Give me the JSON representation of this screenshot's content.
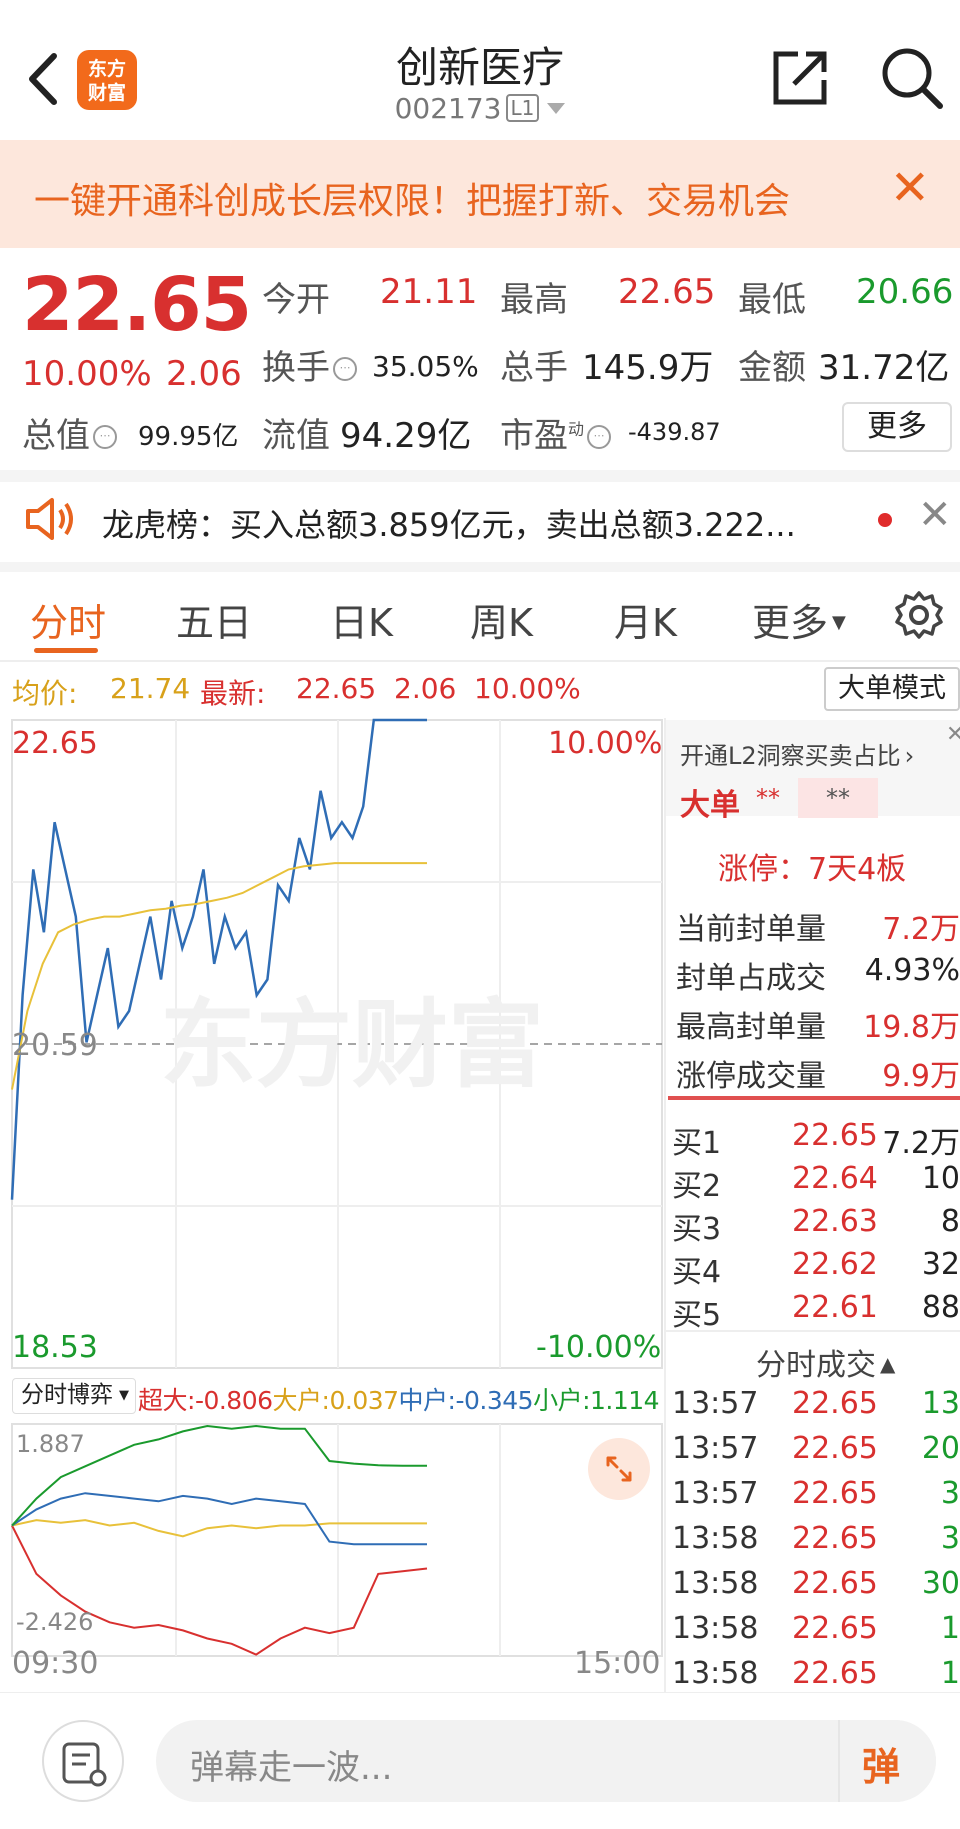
{
  "header": {
    "title": "创新医疗",
    "code": "002173",
    "level_badge": "L1",
    "logo_line1": "东方",
    "logo_line2": "财富"
  },
  "banner": {
    "text": "一键开通科创成长层权限！把握打新、交易机会"
  },
  "quote": {
    "price": "22.65",
    "change_pct": "10.00%",
    "change": "2.06",
    "open_label": "今开",
    "open": "21.11",
    "high_label": "最高",
    "high": "22.65",
    "low_label": "最低",
    "low": "20.66",
    "turnover_label": "换手",
    "turnover": "35.05%",
    "volume_label": "总手",
    "volume": "145.9万",
    "amount_label": "金额",
    "amount": "31.72亿",
    "mktcap_label": "总值",
    "mktcap": "99.95亿",
    "float_label": "流值",
    "float": "94.29亿",
    "pe_label": "市盈",
    "pe_sup": "动",
    "pe": "-439.87",
    "more": "更多"
  },
  "notice": {
    "text": "龙虎榜：买入总额3.859亿元，卖出总额3.222..."
  },
  "tabs": [
    "分时",
    "五日",
    "日K",
    "周K",
    "月K",
    "更多"
  ],
  "info_line": {
    "avg_label": "均价:",
    "avg": "21.74",
    "latest_label": "最新:",
    "latest": "22.65",
    "change": "2.06",
    "pct": "10.00%",
    "mode_button": "大单模式"
  },
  "chart_data": {
    "type": "line",
    "title": "",
    "x_start": "09:30",
    "x_end": "15:00",
    "y_top": "22.65",
    "y_mid": "20.59",
    "y_bottom": "18.53",
    "pct_top": "10.00%",
    "pct_bottom": "-10.00%",
    "ylim": [
      18.53,
      22.65
    ],
    "watermark": "东方财富",
    "series": [
      {
        "color": "#2f6db5",
        "values": [
          19.6,
          20.9,
          21.7,
          21.3,
          22.0,
          21.7,
          21.4,
          20.6,
          20.9,
          21.2,
          20.7,
          20.8,
          21.1,
          21.4,
          21.0,
          21.5,
          21.2,
          21.4,
          21.7,
          21.1,
          21.4,
          21.2,
          21.3,
          20.9,
          21.0,
          21.6,
          21.5,
          21.9,
          21.7,
          22.2,
          21.9,
          22.0,
          21.9,
          22.1,
          22.65,
          22.65,
          22.65,
          22.65,
          22.65,
          22.65
        ]
      },
      {
        "color": "#e8c13a",
        "values": [
          20.3,
          20.8,
          21.1,
          21.3,
          21.35,
          21.38,
          21.4,
          21.4,
          21.42,
          21.44,
          21.45,
          21.47,
          21.48,
          21.5,
          21.52,
          21.55,
          21.6,
          21.65,
          21.7,
          21.72,
          21.73,
          21.74,
          21.74,
          21.74,
          21.74,
          21.74,
          21.74,
          21.74
        ]
      }
    ]
  },
  "flow": {
    "selector": "分时博弈",
    "super_label": "超大:",
    "super": "-0.806",
    "large_label": "大户:",
    "large": "0.037",
    "mid_label": "中户:",
    "mid": "-0.345",
    "small_label": "小户:",
    "small": "1.114",
    "ymax": "1.887",
    "ymin": "-2.426",
    "series": [
      {
        "name": "超大",
        "color": "#d8302f",
        "values": [
          0,
          -0.9,
          -1.3,
          -1.6,
          -1.8,
          -1.9,
          -1.85,
          -1.95,
          -2.1,
          -2.2,
          -2.4,
          -2.1,
          -1.9,
          -2.0,
          -1.9,
          -0.9,
          -0.85,
          -0.8
        ]
      },
      {
        "name": "大户",
        "color": "#e8c13a",
        "values": [
          0,
          0.1,
          0.05,
          0.1,
          0.0,
          0.05,
          -0.1,
          -0.2,
          -0.05,
          0.0,
          -0.05,
          0.0,
          0.0,
          0.04,
          0.04,
          0.04,
          0.04,
          0.04
        ]
      },
      {
        "name": "中户",
        "color": "#2f6db5",
        "values": [
          0,
          0.3,
          0.5,
          0.6,
          0.55,
          0.5,
          0.45,
          0.55,
          0.5,
          0.4,
          0.5,
          0.45,
          0.4,
          -0.3,
          -0.35,
          -0.35,
          -0.35,
          -0.35
        ]
      },
      {
        "name": "小户",
        "color": "#1a9a2d",
        "values": [
          0,
          0.5,
          0.9,
          1.1,
          1.3,
          1.5,
          1.6,
          1.75,
          1.85,
          1.8,
          1.85,
          1.8,
          1.8,
          1.2,
          1.15,
          1.12,
          1.11,
          1.11
        ]
      }
    ]
  },
  "right_panel": {
    "l2_text": "开通L2洞察买卖占比",
    "big_order_label": "大单",
    "big_order_a": "**",
    "big_order_b": "**",
    "limit_up": "涨停：7天4板",
    "stats": [
      {
        "label": "当前封单量",
        "value": "7.2万",
        "color": "red"
      },
      {
        "label": "封单占成交",
        "value": "4.93%",
        "color": "black"
      },
      {
        "label": "最高封单量",
        "value": "19.8万",
        "color": "red"
      },
      {
        "label": "涨停成交量",
        "value": "9.9万",
        "color": "red"
      }
    ],
    "bids": [
      {
        "label": "买1",
        "price": "22.65",
        "vol": "7.2万"
      },
      {
        "label": "买2",
        "price": "22.64",
        "vol": "10"
      },
      {
        "label": "买3",
        "price": "22.63",
        "vol": "8"
      },
      {
        "label": "买4",
        "price": "22.62",
        "vol": "32"
      },
      {
        "label": "买5",
        "price": "22.61",
        "vol": "88"
      }
    ],
    "trades_title": "分时成交",
    "trades": [
      {
        "time": "13:57",
        "price": "22.65",
        "vol": "13"
      },
      {
        "time": "13:57",
        "price": "22.65",
        "vol": "20"
      },
      {
        "time": "13:57",
        "price": "22.65",
        "vol": "3"
      },
      {
        "time": "13:58",
        "price": "22.65",
        "vol": "3"
      },
      {
        "time": "13:58",
        "price": "22.65",
        "vol": "30"
      },
      {
        "time": "13:58",
        "price": "22.65",
        "vol": "1"
      },
      {
        "time": "13:58",
        "price": "22.65",
        "vol": "1"
      }
    ]
  },
  "bottom": {
    "placeholder": "弹幕走一波...",
    "danmu_btn": "弹"
  }
}
